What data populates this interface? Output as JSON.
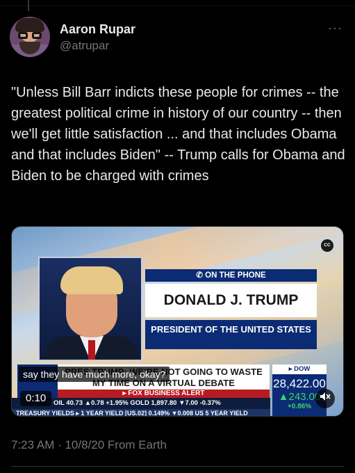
{
  "author": {
    "name": "Aaron Rupar",
    "handle": "@atrupar"
  },
  "tweet": {
    "text": "\"Unless Bill Barr indicts these people for crimes -- the greatest political crime in history of our country -- then we'll get little satisfaction ... and that includes Obama and that includes Biden\" -- Trump calls for Obama and Biden to be charged with crimes",
    "timestamp": "7:23 AM · 10/8/20 From Earth"
  },
  "video": {
    "cc_badge": "CC",
    "phone_label": "✆ ON THE PHONE",
    "name_banner": "DONALD J. TRUMP",
    "title_banner": "PRESIDENT OF THE UNITED STATES",
    "headline": "PRES TRUMP: WE'RE NOT GOING TO WASTE MY TIME ON A VIRTUAL DEBATE",
    "alert": "▸ FOX BUSINESS ALERT",
    "stocks_line": "OIL  40.73 ▲0.78 +1.95%  GOLD  1,897.80 ▼7.00 -0.37%",
    "yields_line": "TREASURY YIELDS ▸ 1 YEAR YIELD [US.02] 0.149% ▼0.008   US 5 YEAR YIELD",
    "dow_label": "▸ DOW FUTURES",
    "dow_value": "28,422.00",
    "dow_change": "▲243.00",
    "dow_pct": "+0.86%",
    "caption": "say they have much more, okay?",
    "elapsed": "0:10",
    "mute_icon": "speaker-muted-icon"
  }
}
